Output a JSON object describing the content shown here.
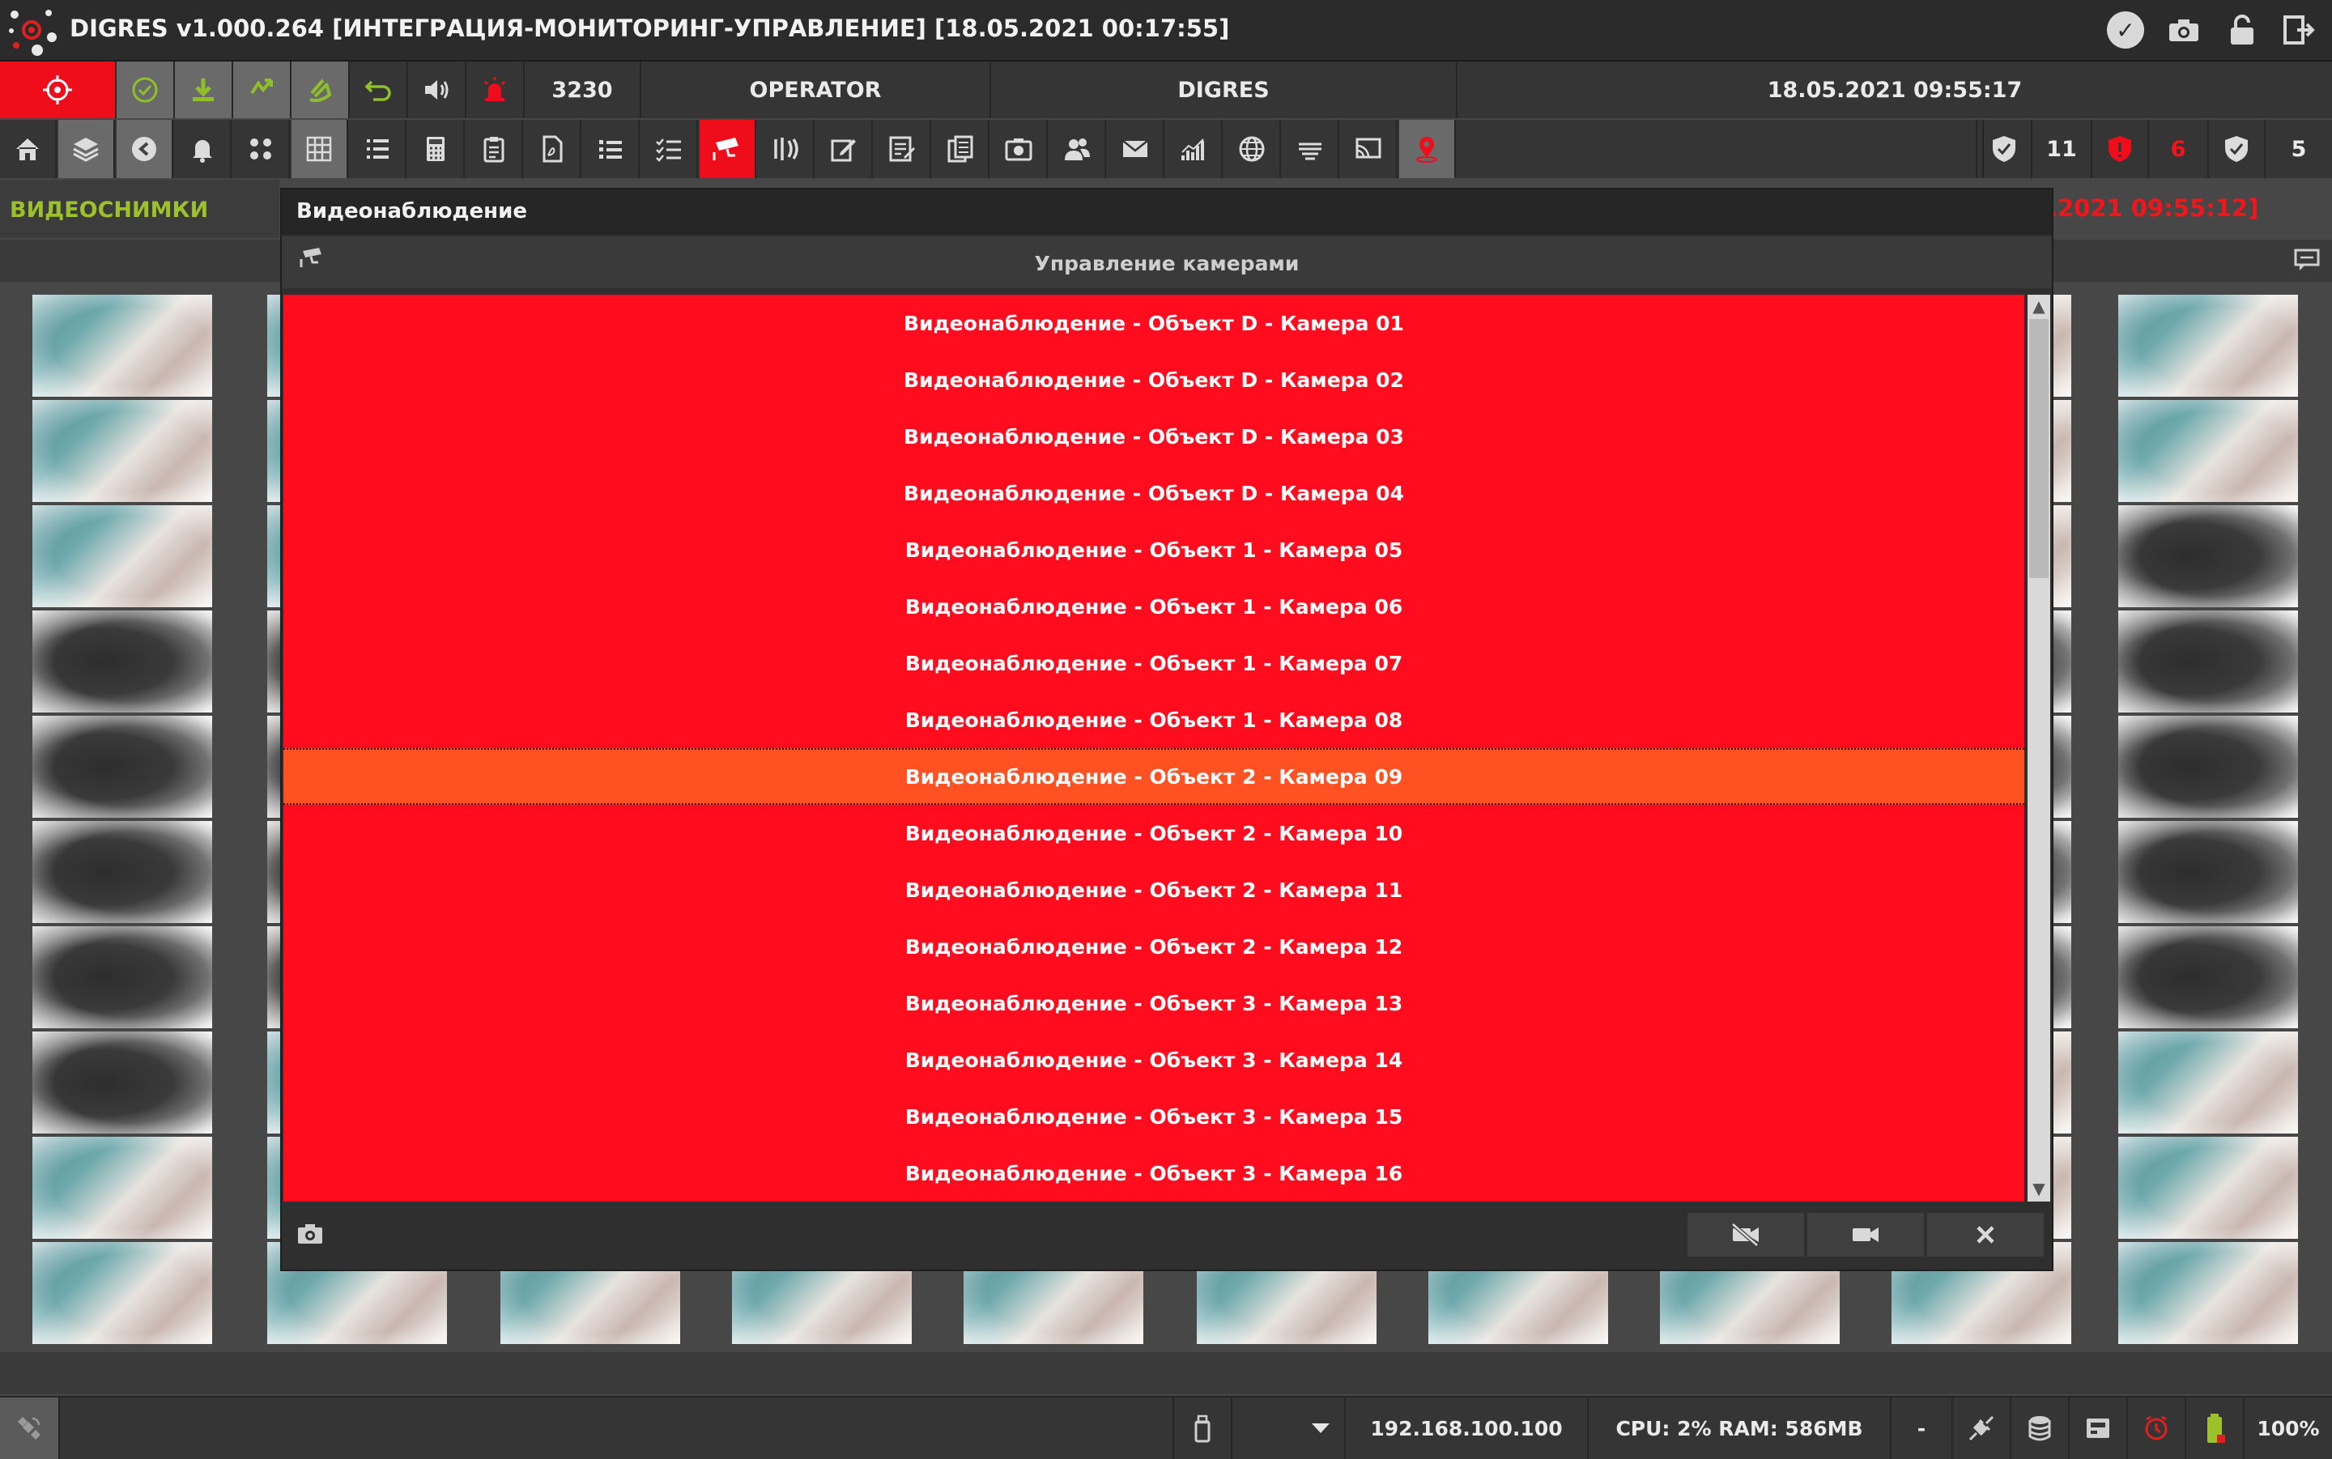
{
  "app": {
    "title": "DIGRES v1.000.264 [ИНТЕГРАЦИЯ-МОНИТОРИНГ-УПРАВЛЕНИЕ] [18.05.2021 00:17:55]",
    "titlebar_icons": [
      "check-circle-icon",
      "camera-icon",
      "lock-icon",
      "exit-icon"
    ]
  },
  "toolbar1": {
    "count": "3230",
    "user": "OPERATOR",
    "system": "DIGRES",
    "datetime": "18.05.2021 09:55:17"
  },
  "toolbar2": {
    "counters": [
      "11",
      "6",
      "5"
    ]
  },
  "left_panel": {
    "title": "ВИДЕОСНИМКИ",
    "right_datetime": ".2021 09:55:12]"
  },
  "modal": {
    "title": "Видеонаблюдение",
    "header": "Управление камерами",
    "selected_index": 8,
    "cameras": [
      "Видеонаблюдение - Объект D - Камера 01",
      "Видеонаблюдение - Объект D - Камера 02",
      "Видеонаблюдение - Объект D - Камера 03",
      "Видеонаблюдение - Объект D - Камера 04",
      "Видеонаблюдение - Объект 1 - Камера 05",
      "Видеонаблюдение - Объект 1 - Камера 06",
      "Видеонаблюдение - Объект 1 - Камера 07",
      "Видеонаблюдение - Объект 1 - Камера 08",
      "Видеонаблюдение - Объект 2 - Камера 09",
      "Видеонаблюдение - Объект 2 - Камера 10",
      "Видеонаблюдение - Объект 2 - Камера 11",
      "Видеонаблюдение - Объект 2 - Камера 12",
      "Видеонаблюдение - Объект 3 - Камера 13",
      "Видеонаблюдение - Объект 3 - Камера 14",
      "Видеонаблюдение - Объект 3 - Камера 15",
      "Видеонаблюдение - Объект 3 - Камера 16"
    ]
  },
  "statusbar": {
    "dash": "-",
    "ip": "192.168.100.100",
    "cpu_ram": "CPU: 2% RAM: 586MB",
    "zoom": "100%"
  },
  "colors": {
    "alarm_red": "#ff0d1e",
    "selected_row": "#ff5121",
    "accent_green": "#9dc12b",
    "date_red": "#f4141c"
  }
}
